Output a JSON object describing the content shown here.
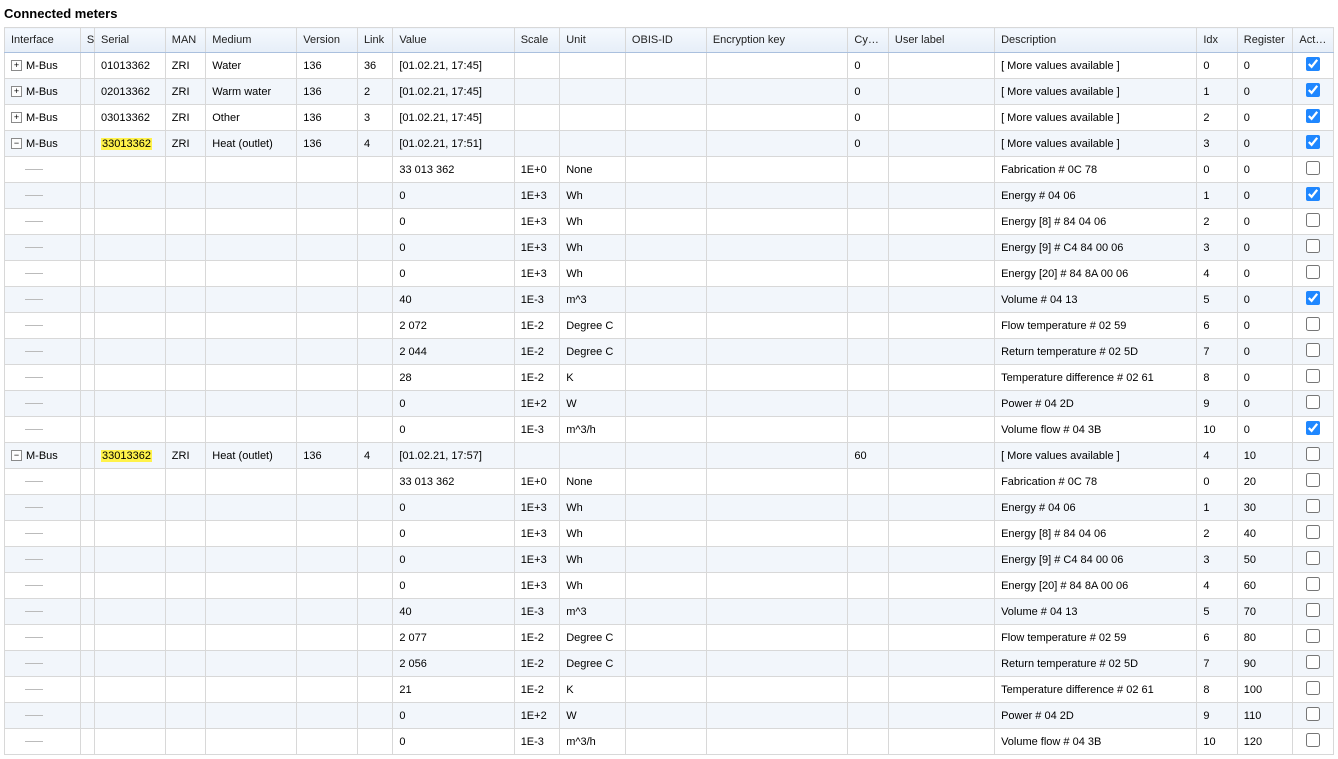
{
  "title": "Connected meters",
  "columns": [
    "Interface",
    "S",
    "Serial",
    "MAN",
    "Medium",
    "Version",
    "Link",
    "Value",
    "Scale",
    "Unit",
    "OBIS-ID",
    "Encryption key",
    "Cycle",
    "User label",
    "Description",
    "Idx",
    "Register",
    "Active"
  ],
  "rows": [
    {
      "type": "meter",
      "exp": "plus",
      "iface": "M-Bus",
      "serial": "01013362",
      "hl": false,
      "man": "ZRI",
      "medium": "Water",
      "version": "136",
      "link": "36",
      "value": "[01.02.21, 17:45]",
      "scale": "",
      "unit": "",
      "obis": "",
      "enc": "",
      "cycle": "0",
      "ulabel": "",
      "desc": "[ More values available ]",
      "idx": "0",
      "reg": "0",
      "active": true
    },
    {
      "type": "meter",
      "exp": "plus",
      "iface": "M-Bus",
      "serial": "02013362",
      "hl": false,
      "man": "ZRI",
      "medium": "Warm water",
      "version": "136",
      "link": "2",
      "value": "[01.02.21, 17:45]",
      "scale": "",
      "unit": "",
      "obis": "",
      "enc": "",
      "cycle": "0",
      "ulabel": "",
      "desc": "[ More values available ]",
      "idx": "1",
      "reg": "0",
      "active": true
    },
    {
      "type": "meter",
      "exp": "plus",
      "iface": "M-Bus",
      "serial": "03013362",
      "hl": false,
      "man": "ZRI",
      "medium": "Other",
      "version": "136",
      "link": "3",
      "value": "[01.02.21, 17:45]",
      "scale": "",
      "unit": "",
      "obis": "",
      "enc": "",
      "cycle": "0",
      "ulabel": "",
      "desc": "[ More values available ]",
      "idx": "2",
      "reg": "0",
      "active": true
    },
    {
      "type": "meter",
      "exp": "minus",
      "iface": "M-Bus",
      "serial": "33013362",
      "hl": true,
      "man": "ZRI",
      "medium": "Heat (outlet)",
      "version": "136",
      "link": "4",
      "value": "[01.02.21, 17:51]",
      "scale": "",
      "unit": "",
      "obis": "",
      "enc": "",
      "cycle": "0",
      "ulabel": "",
      "desc": "[ More values available ]",
      "idx": "3",
      "reg": "0",
      "active": true
    },
    {
      "type": "val",
      "value": "33 013 362",
      "scale": "1E+0",
      "unit": "None",
      "desc": "Fabrication # 0C 78",
      "idx": "0",
      "reg": "0",
      "active": false
    },
    {
      "type": "val",
      "value": "0",
      "scale": "1E+3",
      "unit": "Wh",
      "desc": "Energy # 04 06",
      "idx": "1",
      "reg": "0",
      "active": true
    },
    {
      "type": "val",
      "value": "0",
      "scale": "1E+3",
      "unit": "Wh",
      "desc": "Energy [8] # 84 04 06",
      "idx": "2",
      "reg": "0",
      "active": false
    },
    {
      "type": "val",
      "value": "0",
      "scale": "1E+3",
      "unit": "Wh",
      "desc": "Energy [9] # C4 84 00 06",
      "idx": "3",
      "reg": "0",
      "active": false
    },
    {
      "type": "val",
      "value": "0",
      "scale": "1E+3",
      "unit": "Wh",
      "desc": "Energy [20] # 84 8A 00 06",
      "idx": "4",
      "reg": "0",
      "active": false
    },
    {
      "type": "val",
      "value": "40",
      "scale": "1E-3",
      "unit": "m^3",
      "desc": "Volume # 04 13",
      "idx": "5",
      "reg": "0",
      "active": true
    },
    {
      "type": "val",
      "value": "2 072",
      "scale": "1E-2",
      "unit": "Degree C",
      "desc": "Flow temperature # 02 59",
      "idx": "6",
      "reg": "0",
      "active": false
    },
    {
      "type": "val",
      "value": "2 044",
      "scale": "1E-2",
      "unit": "Degree C",
      "desc": "Return temperature # 02 5D",
      "idx": "7",
      "reg": "0",
      "active": false
    },
    {
      "type": "val",
      "value": "28",
      "scale": "1E-2",
      "unit": "K",
      "desc": "Temperature difference # 02 61",
      "idx": "8",
      "reg": "0",
      "active": false
    },
    {
      "type": "val",
      "value": "0",
      "scale": "1E+2",
      "unit": "W",
      "desc": "Power # 04 2D",
      "idx": "9",
      "reg": "0",
      "active": false
    },
    {
      "type": "val",
      "value": "0",
      "scale": "1E-3",
      "unit": "m^3/h",
      "desc": "Volume flow # 04 3B",
      "idx": "10",
      "reg": "0",
      "active": true
    },
    {
      "type": "meter",
      "exp": "minus",
      "iface": "M-Bus",
      "serial": "33013362",
      "hl": true,
      "man": "ZRI",
      "medium": "Heat (outlet)",
      "version": "136",
      "link": "4",
      "value": "[01.02.21, 17:57]",
      "scale": "",
      "unit": "",
      "obis": "",
      "enc": "",
      "cycle": "60",
      "ulabel": "",
      "desc": "[ More values available ]",
      "idx": "4",
      "reg": "10",
      "active": false
    },
    {
      "type": "val",
      "value": "33 013 362",
      "scale": "1E+0",
      "unit": "None",
      "desc": "Fabrication # 0C 78",
      "idx": "0",
      "reg": "20",
      "active": false
    },
    {
      "type": "val",
      "value": "0",
      "scale": "1E+3",
      "unit": "Wh",
      "desc": "Energy # 04 06",
      "idx": "1",
      "reg": "30",
      "active": false
    },
    {
      "type": "val",
      "value": "0",
      "scale": "1E+3",
      "unit": "Wh",
      "desc": "Energy [8] # 84 04 06",
      "idx": "2",
      "reg": "40",
      "active": false
    },
    {
      "type": "val",
      "value": "0",
      "scale": "1E+3",
      "unit": "Wh",
      "desc": "Energy [9] # C4 84 00 06",
      "idx": "3",
      "reg": "50",
      "active": false
    },
    {
      "type": "val",
      "value": "0",
      "scale": "1E+3",
      "unit": "Wh",
      "desc": "Energy [20] # 84 8A 00 06",
      "idx": "4",
      "reg": "60",
      "active": false
    },
    {
      "type": "val",
      "value": "40",
      "scale": "1E-3",
      "unit": "m^3",
      "desc": "Volume # 04 13",
      "idx": "5",
      "reg": "70",
      "active": false
    },
    {
      "type": "val",
      "value": "2 077",
      "scale": "1E-2",
      "unit": "Degree C",
      "desc": "Flow temperature # 02 59",
      "idx": "6",
      "reg": "80",
      "active": false
    },
    {
      "type": "val",
      "value": "2 056",
      "scale": "1E-2",
      "unit": "Degree C",
      "desc": "Return temperature # 02 5D",
      "idx": "7",
      "reg": "90",
      "active": false
    },
    {
      "type": "val",
      "value": "21",
      "scale": "1E-2",
      "unit": "K",
      "desc": "Temperature difference # 02 61",
      "idx": "8",
      "reg": "100",
      "active": false
    },
    {
      "type": "val",
      "value": "0",
      "scale": "1E+2",
      "unit": "W",
      "desc": "Power # 04 2D",
      "idx": "9",
      "reg": "110",
      "active": false
    },
    {
      "type": "val",
      "value": "0",
      "scale": "1E-3",
      "unit": "m^3/h",
      "desc": "Volume flow # 04 3B",
      "idx": "10",
      "reg": "120",
      "active": false
    }
  ]
}
